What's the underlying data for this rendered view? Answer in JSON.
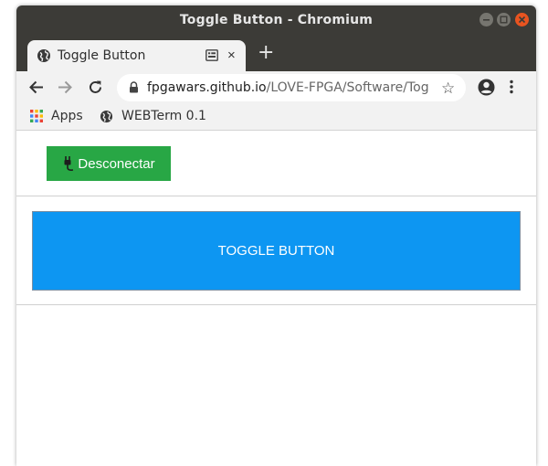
{
  "window": {
    "title": "Toggle Button - Chromium"
  },
  "tab": {
    "title": "Toggle Button",
    "close_label": "×",
    "new_tab_label": "+"
  },
  "toolbar": {
    "url_host": "fpgawars.github.io",
    "url_path": "/LOVE-FPGA/Software/Tog..."
  },
  "bookmarks": [
    {
      "label": "Apps",
      "icon": "apps-grid-icon"
    },
    {
      "label": "WEBTerm 0.1",
      "icon": "globe-icon"
    }
  ],
  "page": {
    "connect_button_label": "Desconectar",
    "toggle_button_label": "TOGGLE BUTTON"
  },
  "colors": {
    "titlebar": "#3c3b37",
    "close_button": "#e95420",
    "connect_button": "#28a745",
    "toggle_button": "#0d96f2"
  }
}
